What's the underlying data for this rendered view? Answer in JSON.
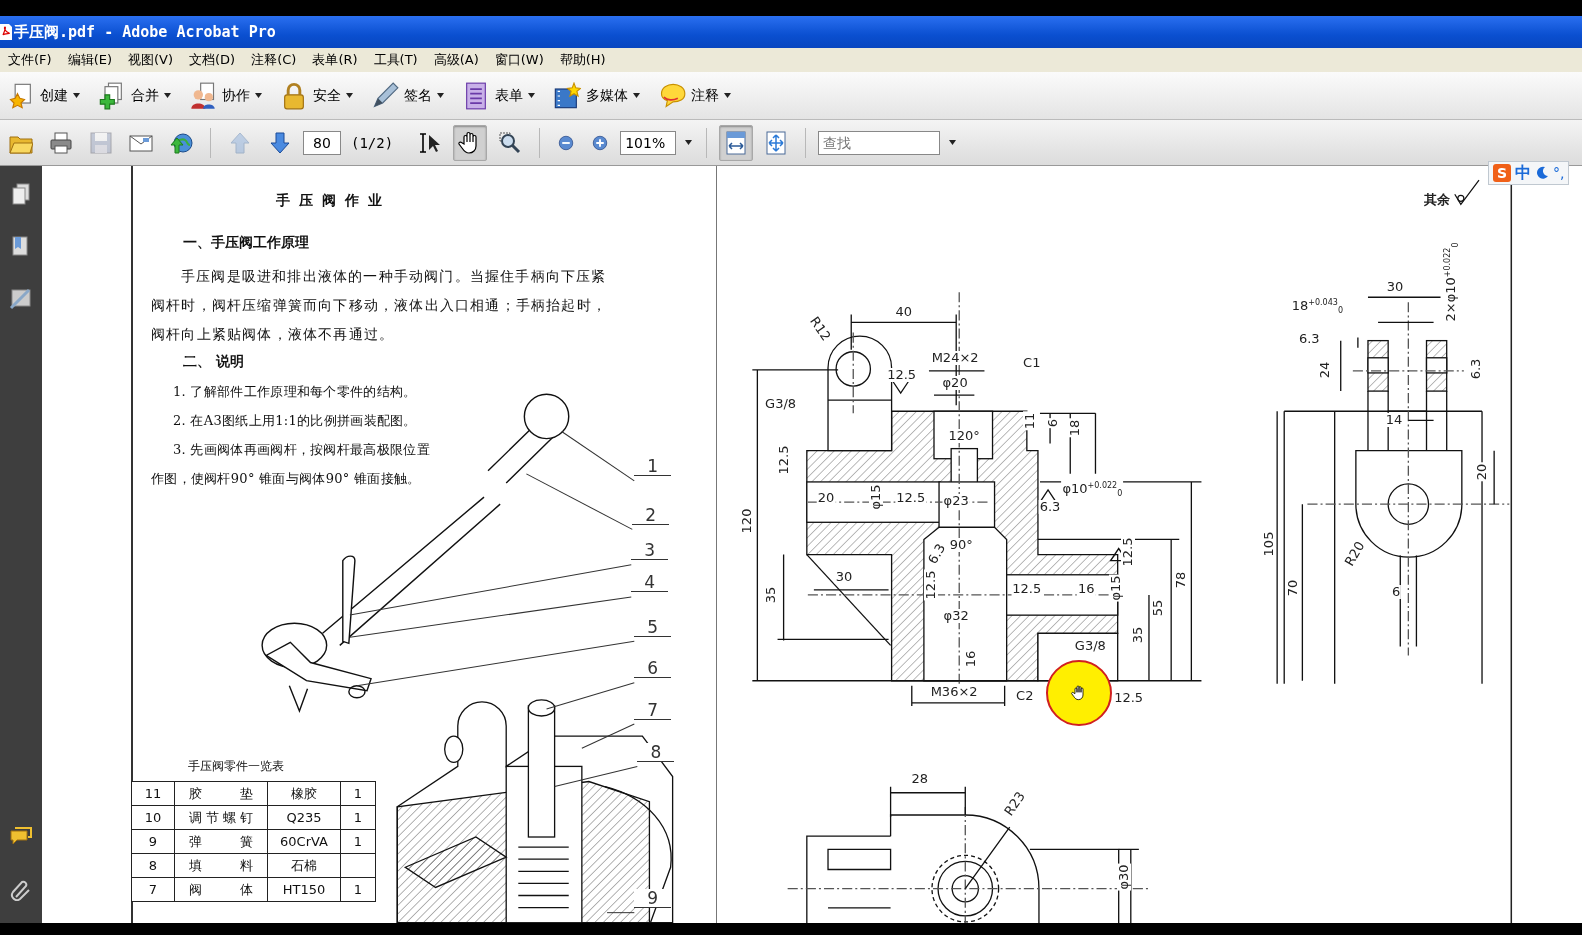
{
  "window": {
    "title": "手压阀.pdf - Adobe Acrobat Pro"
  },
  "menu": [
    "文件(F)",
    "编辑(E)",
    "视图(V)",
    "文档(D)",
    "注释(C)",
    "表单(R)",
    "工具(T)",
    "高级(A)",
    "窗口(W)",
    "帮助(H)"
  ],
  "task_toolbar": [
    {
      "kind": "create",
      "label": "创建"
    },
    {
      "kind": "combine",
      "label": "合并"
    },
    {
      "kind": "collaborate",
      "label": "协作"
    },
    {
      "kind": "secure",
      "label": "安全"
    },
    {
      "kind": "sign",
      "label": "签名"
    },
    {
      "kind": "forms",
      "label": "表单"
    },
    {
      "kind": "multimedia",
      "label": "多媒体"
    },
    {
      "kind": "comment",
      "label": "注释"
    }
  ],
  "nav_toolbar": {
    "buttons": [
      {
        "kind": "open",
        "disabled": false
      },
      {
        "kind": "print",
        "disabled": false
      },
      {
        "kind": "save",
        "disabled": true
      },
      {
        "kind": "email",
        "disabled": false
      },
      {
        "kind": "upload",
        "disabled": false
      },
      {
        "kind": "prev",
        "disabled": true
      },
      {
        "kind": "next",
        "disabled": false
      }
    ],
    "page_field": "80",
    "page_count": "(1/2)",
    "tools": [
      {
        "kind": "select",
        "selected": false
      },
      {
        "kind": "hand",
        "selected": true
      },
      {
        "kind": "marquee_zoom",
        "selected": false
      }
    ],
    "zoom_buttons": [
      {
        "kind": "zoom_out"
      },
      {
        "kind": "zoom_in"
      }
    ],
    "zoom_field": "101%",
    "view_buttons": [
      {
        "kind": "fit_width",
        "selected": true
      },
      {
        "kind": "fit_page",
        "selected": false
      }
    ],
    "search": {
      "placeholder": "查找"
    }
  },
  "ime_bar": {
    "logo": "S",
    "mode": "中",
    "punctuation": "°,"
  },
  "side_panel": [
    {
      "kind": "pages"
    },
    {
      "kind": "bookmarks"
    },
    {
      "kind": "signatures"
    },
    {
      "kind": "comments"
    },
    {
      "kind": "attachments"
    }
  ],
  "page_1": {
    "title": "手压阀作业",
    "heading_1": "一、手压阀工作原理",
    "paragraph": "手压阀是吸进和排出液体的一种手动阀门。当握住手柄向下压紧阀杆时，阀杆压缩弹簧而向下移动，液体出入口相通；手柄抬起时，阀杆向上紧贴阀体，液体不再通过。",
    "heading_2": "二、 说明",
    "items": [
      "1. 了解部件工作原理和每个零件的结构。",
      "2. 在A3图纸上用1:1的比例拼画装配图。",
      "3. 先画阀体再画阀杆，按阀杆最高极限位置作图，使阀杆90° 锥面与阀体90° 锥面接触。"
    ],
    "callouts": [
      "1",
      "2",
      "3",
      "4",
      "5",
      "6",
      "7",
      "8",
      "9"
    ],
    "parts_table": {
      "title": "手压阀零件一览表",
      "rows": [
        [
          "11",
          "胶垫",
          "橡胶",
          "1"
        ],
        [
          "10",
          "调节螺钉",
          "Q235",
          "1"
        ],
        [
          "9",
          "弹簧",
          "60CrVA",
          "1"
        ],
        [
          "8",
          "填料",
          "石棉"
        ],
        [
          "7",
          "阀体",
          "HT150",
          "1"
        ]
      ]
    }
  },
  "page_2": {
    "note": "其余",
    "section_view_labels": [
      "40",
      "R12",
      "M24×2",
      "C1",
      "12.5",
      "φ20",
      "G3/8",
      "11",
      "6",
      "18",
      "120°",
      "12.5",
      "20",
      "φ15",
      "12.5",
      "φ23",
      "φ10$^{+0.022}$$_{0}$",
      "6.3",
      "120",
      "90°",
      "6.3",
      "12.5",
      "30",
      "35",
      "12.5",
      "12.5",
      "16",
      "φ15",
      "78",
      "55",
      "φ32",
      "35",
      "G3/8",
      "16",
      "M36×2",
      "C2",
      "12.5"
    ],
    "side_view_labels": [
      "30",
      "18$^{+0.043}$$_{0}$",
      "2×φ10$^{+0.022}$$_{0}$",
      "6.3",
      "24",
      "6.3",
      "14",
      "20",
      "105",
      "R20",
      "70",
      "6"
    ],
    "bottom_view_labels": [
      "28",
      "R23",
      "φ30"
    ]
  },
  "cursor_highlight": true
}
